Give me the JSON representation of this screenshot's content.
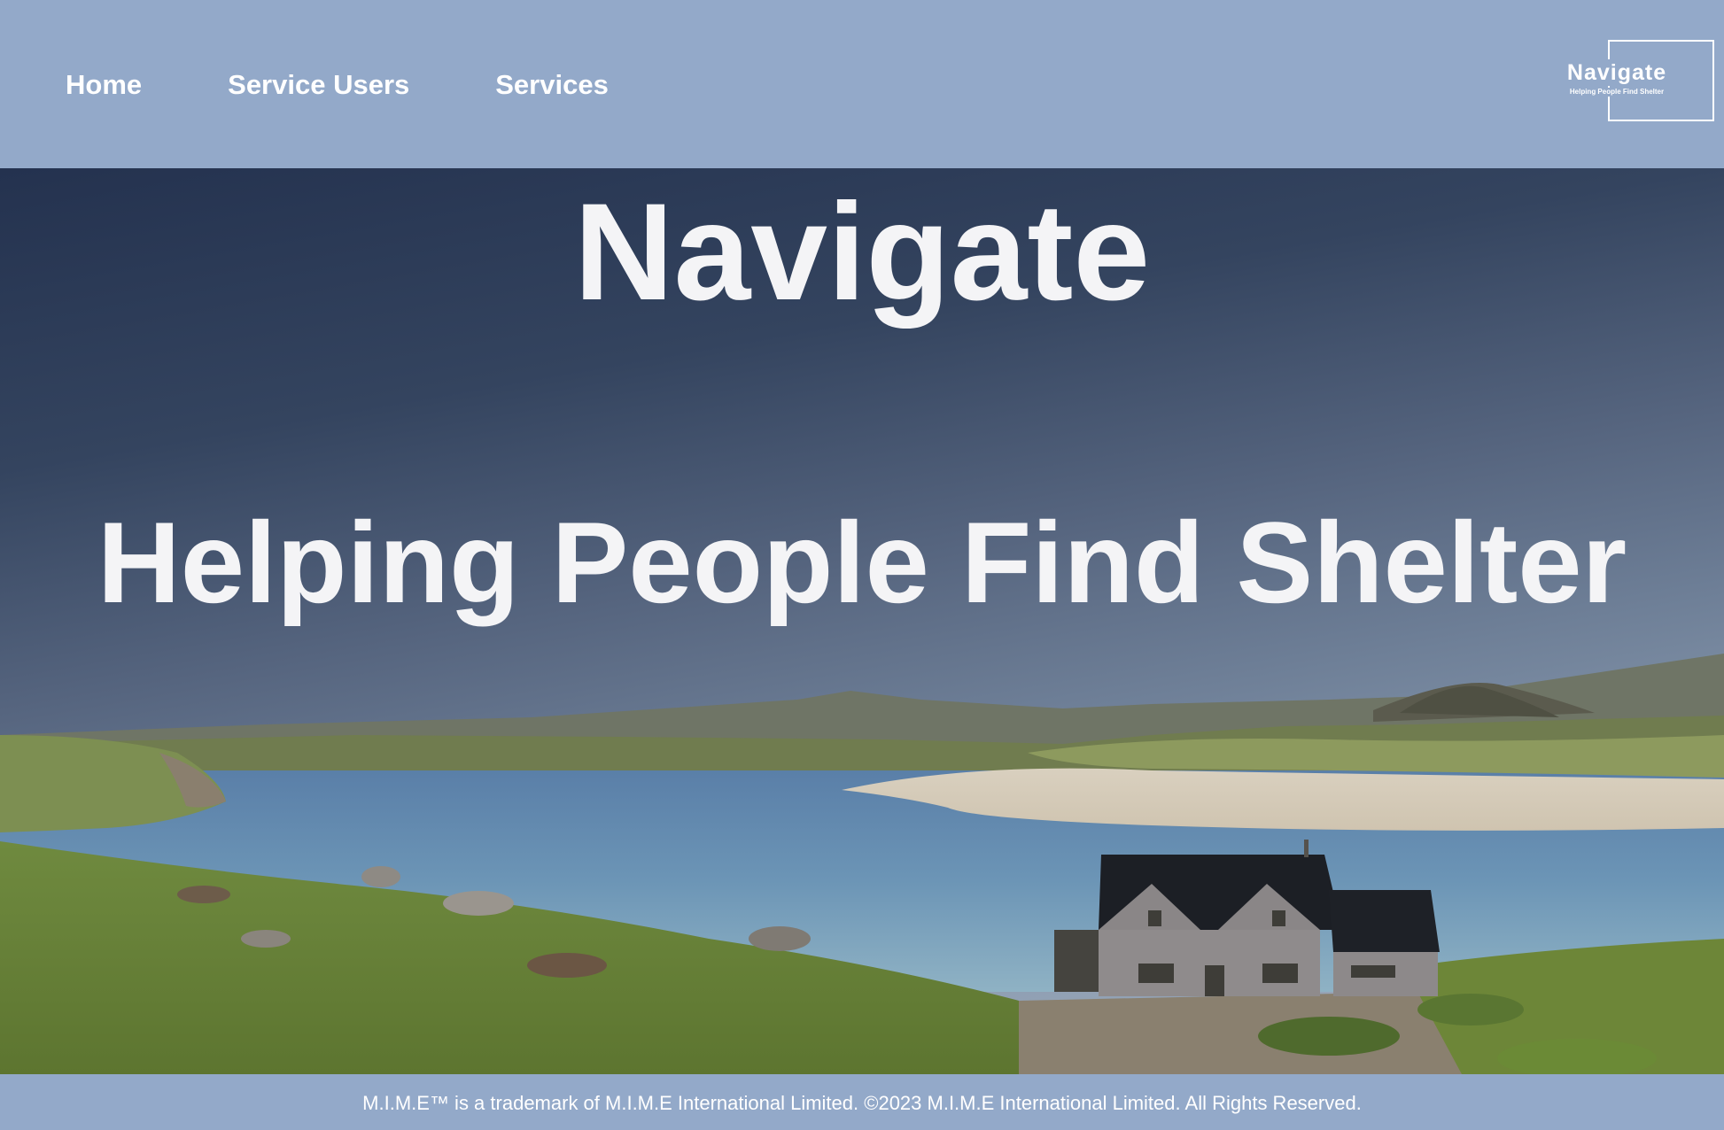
{
  "header": {
    "nav": [
      {
        "label": "Home"
      },
      {
        "label": "Service Users"
      },
      {
        "label": "Services"
      }
    ],
    "logo": {
      "title": "Navigate",
      "subtitle": "Helping People Find Shelter"
    }
  },
  "hero": {
    "title": "Navigate",
    "subtitle": "Helping People Find Shelter",
    "image_icon": "landscape-photo"
  },
  "footer": {
    "text": "M.I.M.E™ is a trademark of M.I.M.E International Limited. ©2023 M.I.M.E International Limited. All Rights Reserved."
  },
  "colors": {
    "header_bg": "#93a9c9",
    "footer_bg": "#93a9c9",
    "text": "#ffffff"
  }
}
